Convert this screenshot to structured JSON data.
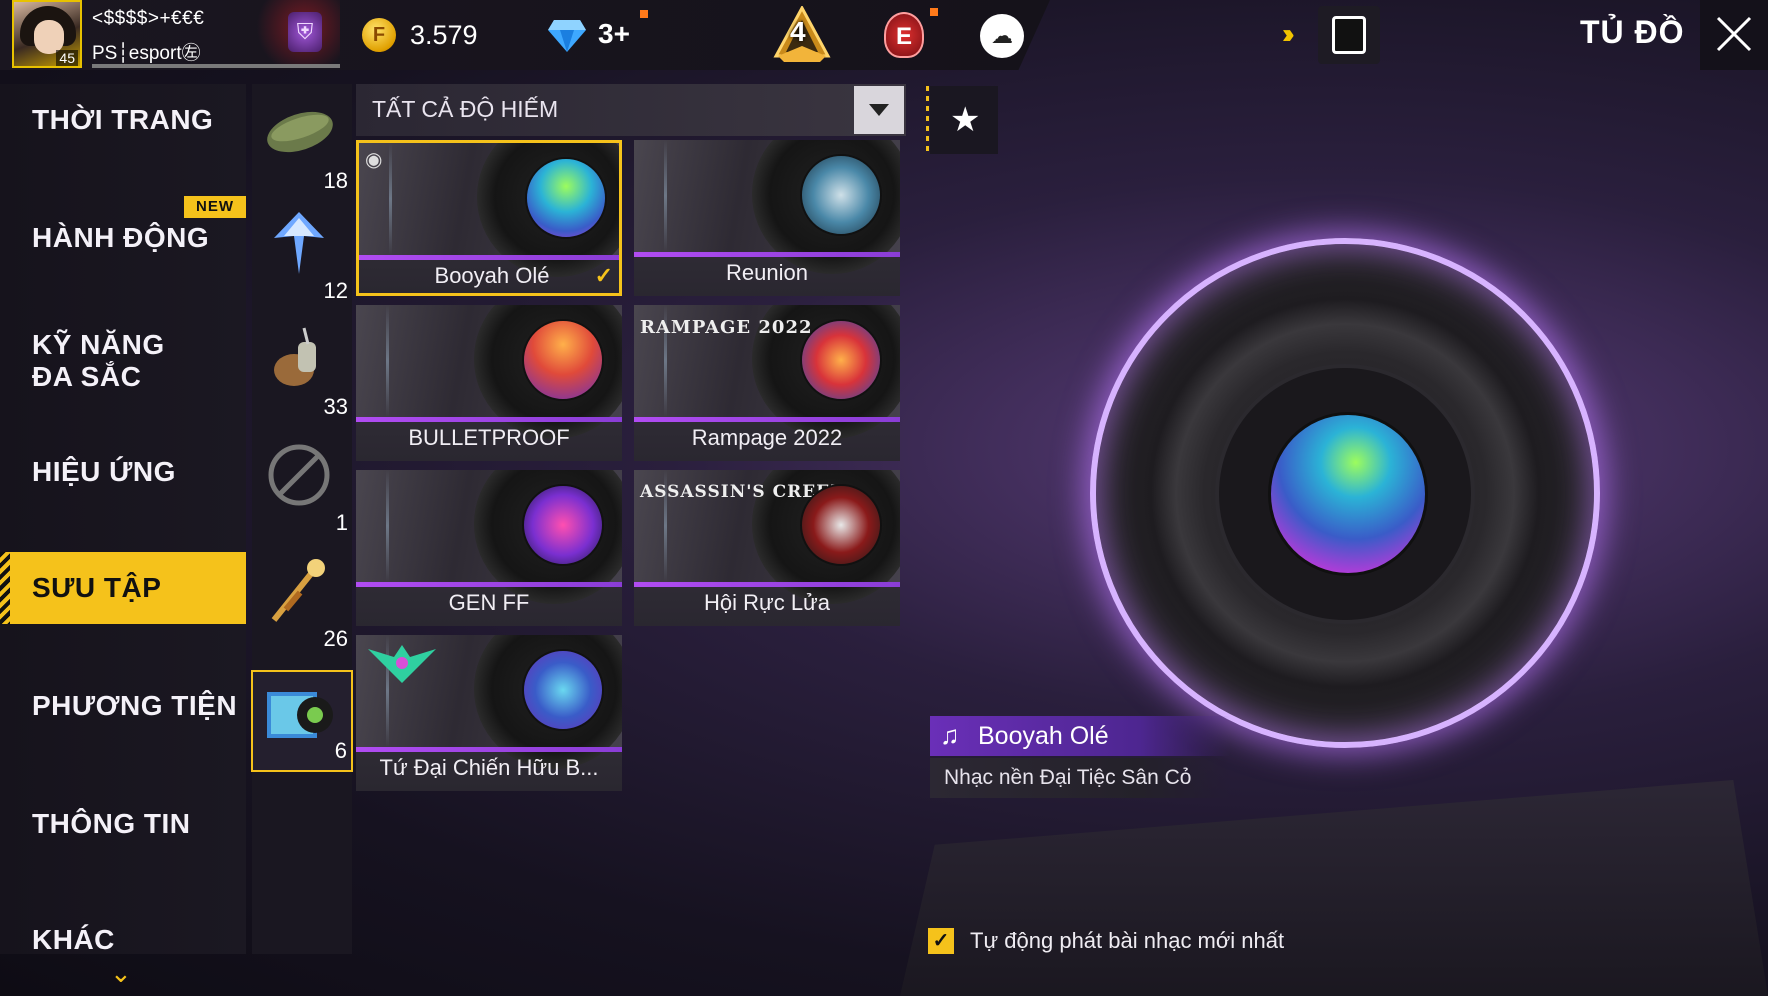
{
  "player": {
    "name": "<$$$$>+€€€",
    "guild": "PS┆esport㊧",
    "level": "45"
  },
  "currency": {
    "gold": "3.579",
    "diamonds": "3+"
  },
  "rank": {
    "number": "4",
    "badge_letter": "E"
  },
  "header": {
    "title": "TỦ ĐỒ"
  },
  "menu": {
    "items": [
      {
        "label": "THỜI TRANG"
      },
      {
        "label": "HÀNH ĐỘNG"
      },
      {
        "label": "KỸ NĂNG ĐA SẮC"
      },
      {
        "label": "HIỆU ỨNG"
      },
      {
        "label": "SƯU TẬP"
      },
      {
        "label": "PHƯƠNG TIỆN"
      },
      {
        "label": "THÔNG TIN"
      },
      {
        "label": "KHÁC"
      }
    ],
    "new_badge": "NEW"
  },
  "subcategories": [
    {
      "icon": "parachute-icon",
      "count": "18"
    },
    {
      "icon": "glider-icon",
      "count": "12"
    },
    {
      "icon": "pet-icon",
      "count": "33"
    },
    {
      "icon": "emote-icon",
      "count": "1"
    },
    {
      "icon": "weapon-skin-icon",
      "count": "26"
    },
    {
      "icon": "music-album-icon",
      "count": "6"
    }
  ],
  "filter": {
    "label": "TẤT CẢ ĐỘ HIẾM"
  },
  "songs": [
    {
      "name": "Booyah Olé",
      "selected": true
    },
    {
      "name": "Reunion"
    },
    {
      "name": "BULLETPROOF"
    },
    {
      "name": "Rampage 2022",
      "logo": "RAMPAGE 2022"
    },
    {
      "name": "GEN FF"
    },
    {
      "name": "Hội Rực Lửa",
      "logo": "ASSASSIN'S CREED"
    },
    {
      "name": "Tứ Đại Chiến Hữu B..."
    }
  ],
  "preview": {
    "title": "Booyah Olé",
    "subtitle": "Nhạc nền Đại Tiệc Sân Cỏ"
  },
  "autoplay": {
    "label": "Tự động phát bài nhạc mới nhất",
    "checked": true
  },
  "colors": {
    "accent": "#f5c21b",
    "purple": "#b14cf2"
  }
}
